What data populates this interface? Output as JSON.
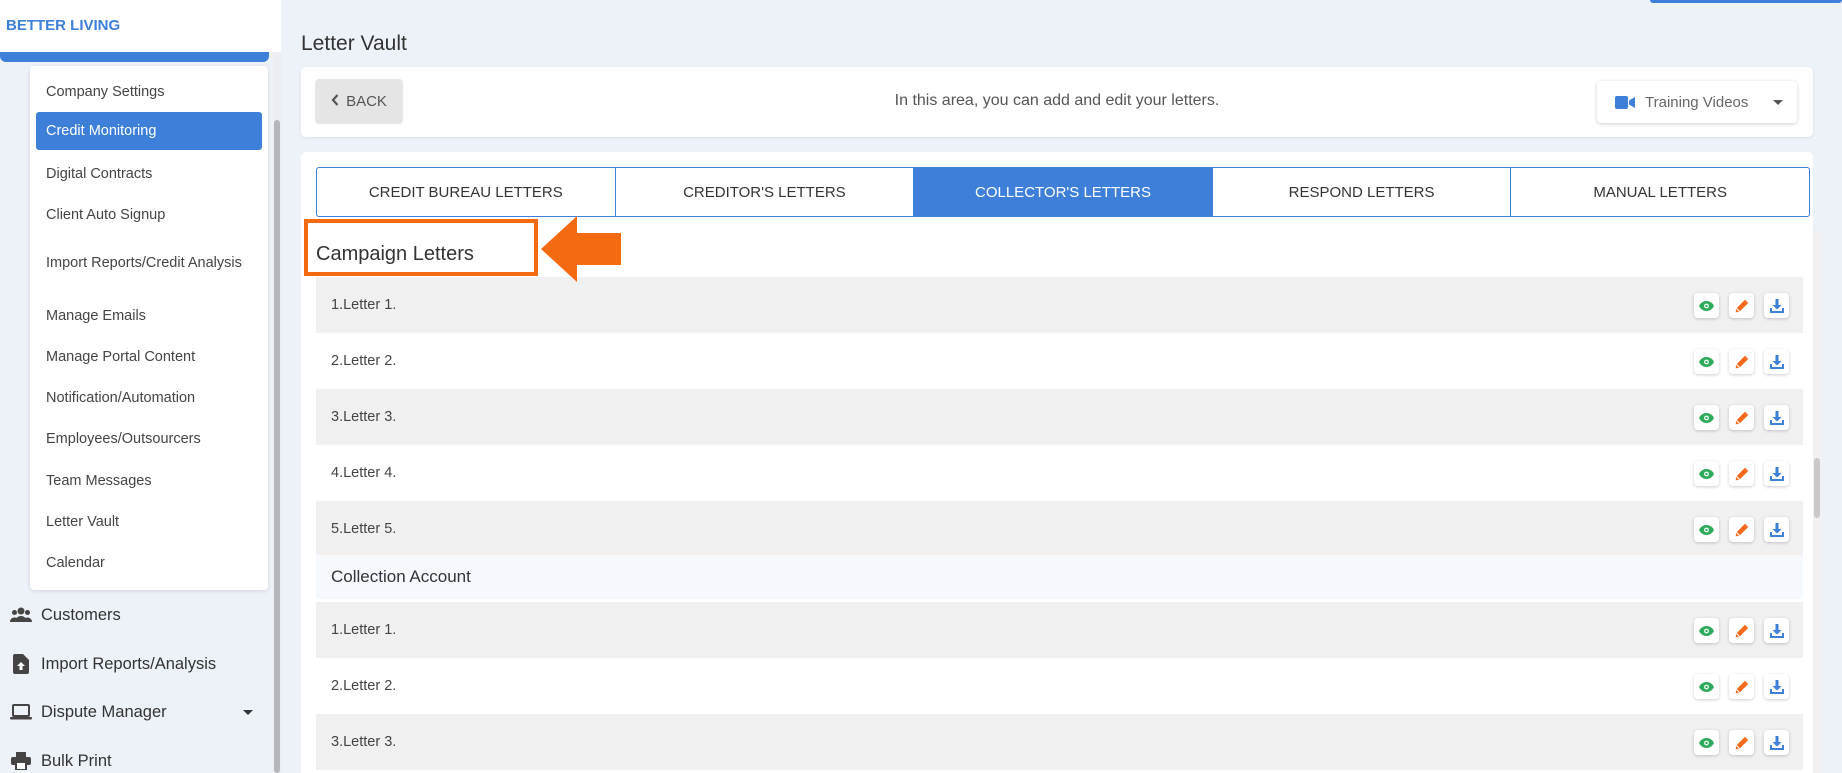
{
  "brand": {
    "name": "BETTER LIVING"
  },
  "submenu": {
    "items": [
      {
        "label": "Company Settings",
        "active": false
      },
      {
        "label": "Credit Monitoring",
        "active": true
      },
      {
        "label": "Digital Contracts",
        "active": false
      },
      {
        "label": "Client Auto Signup",
        "active": false
      },
      {
        "label": "Import Reports/Credit Analysis",
        "active": false
      },
      {
        "label": "Manage Emails",
        "active": false
      },
      {
        "label": "Manage Portal Content",
        "active": false
      },
      {
        "label": "Notification/Automation",
        "active": false
      },
      {
        "label": "Employees/Outsourcers",
        "active": false
      },
      {
        "label": "Team Messages",
        "active": false
      },
      {
        "label": "Letter Vault",
        "active": false
      },
      {
        "label": "Calendar",
        "active": false
      }
    ]
  },
  "nav": {
    "items": [
      {
        "label": "Customers",
        "icon": "users-icon"
      },
      {
        "label": "Import Reports/Analysis",
        "icon": "file-upload-icon"
      },
      {
        "label": "Dispute Manager",
        "icon": "laptop-icon"
      },
      {
        "label": "Bulk Print",
        "icon": "printer-icon"
      }
    ]
  },
  "page": {
    "title": "Letter Vault",
    "back_label": "BACK",
    "header_text": "In this area, you can add and edit your letters.",
    "training_label": "Training Videos"
  },
  "tabs": [
    {
      "label": "CREDIT BUREAU LETTERS",
      "active": false
    },
    {
      "label": "CREDITOR'S LETTERS",
      "active": false
    },
    {
      "label": "COLLECTOR'S LETTERS",
      "active": true
    },
    {
      "label": "RESPOND LETTERS",
      "active": false
    },
    {
      "label": "MANUAL LETTERS",
      "active": false
    }
  ],
  "sections": [
    {
      "title": "Campaign Letters",
      "letters": [
        "1.Letter 1.",
        "2.Letter 2.",
        "3.Letter 3.",
        "4.Letter 4.",
        "5.Letter 5."
      ]
    },
    {
      "title": "Collection Account",
      "letters": [
        "1.Letter 1.",
        "2.Letter 2.",
        "3.Letter 3."
      ]
    }
  ],
  "colors": {
    "accent": "#3d7fd9",
    "view": "#2eaa5c",
    "edit": "#f26a1b",
    "download": "#3d7fd9",
    "annotation": "#f46a10"
  }
}
